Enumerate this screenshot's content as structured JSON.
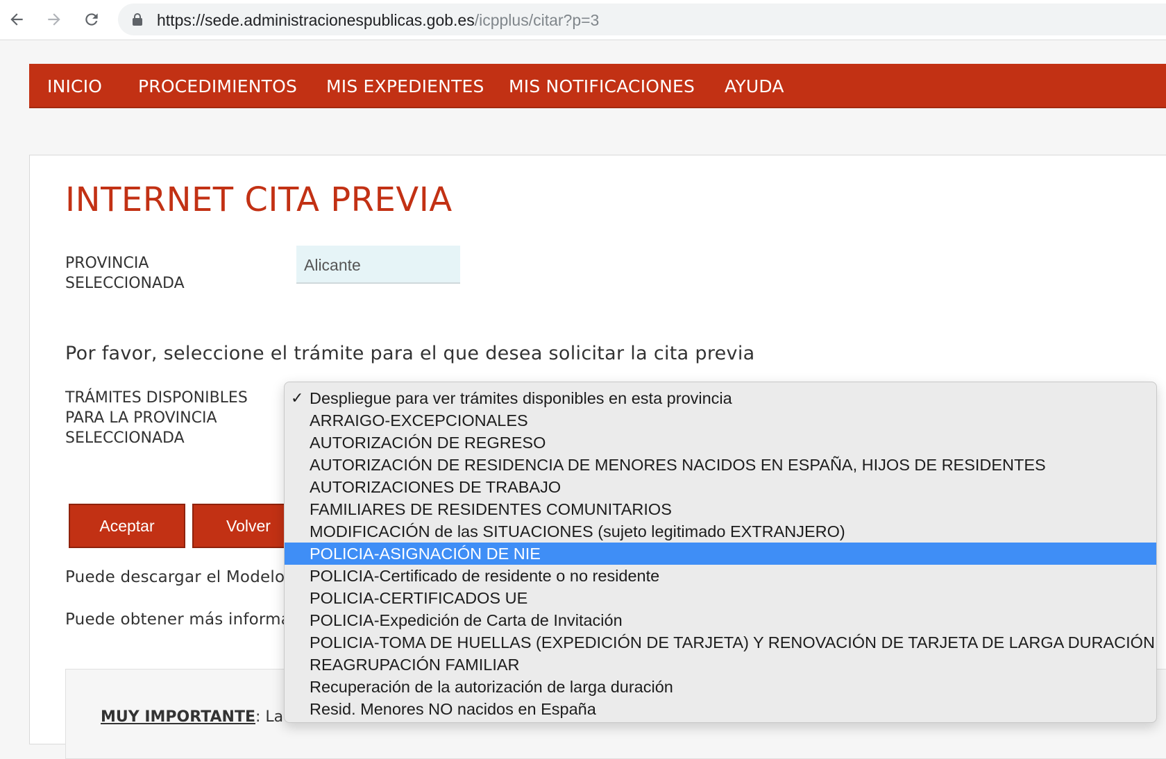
{
  "browser": {
    "url_host": "https://sede.administracionespublicas.gob.es",
    "url_path": "/icpplus/citar?p=3"
  },
  "nav": {
    "items": [
      "INICIO",
      "PROCEDIMIENTOS",
      "MIS EXPEDIENTES",
      "MIS NOTIFICACIONES",
      "AYUDA"
    ]
  },
  "page": {
    "title": "INTERNET CITA PREVIA",
    "province_label_1": "PROVINCIA",
    "province_label_2": "SELECCIONADA",
    "province_value": "Alicante",
    "instruction": "Por favor, seleccione el trámite para el que desea solicitar la cita previa",
    "tramites_label_1": "TRÁMITES DISPONIBLES",
    "tramites_label_2": "PARA LA PROVINCIA",
    "tramites_label_3": "SELECCIONADA",
    "accept_label": "Aceptar",
    "back_label": "Volver",
    "download_text": "Puede descargar el Modelo",
    "info_text": "Puede obtener más informa",
    "important_label": "MUY IMPORTANTE",
    "important_text": ": La"
  },
  "dropdown": {
    "checked_mark": "✓",
    "selected_index": 7,
    "options": [
      "Despliegue para ver trámites disponibles en esta provincia",
      "ARRAIGO-EXCEPCIONALES",
      "AUTORIZACIÓN DE REGRESO",
      "AUTORIZACIÓN DE RESIDENCIA DE MENORES NACIDOS EN ESPAÑA, HIJOS DE RESIDENTES",
      "AUTORIZACIONES DE TRABAJO",
      "FAMILIARES DE RESIDENTES COMUNITARIOS",
      "MODIFICACIÓN de las SITUACIONES (sujeto legitimado EXTRANJERO)",
      "POLICIA-ASIGNACIÓN DE NIE",
      "POLICIA-Certificado de residente o no residente",
      "POLICIA-CERTIFICADOS UE",
      "POLICIA-Expedición de Carta de Invitación",
      "POLICIA-TOMA DE HUELLAS (EXPEDICIÓN DE TARJETA) Y RENOVACIÓN DE TARJETA DE LARGA DURACIÓN",
      "REAGRUPACIÓN FAMILIAR",
      "Recuperación de la autorización de larga duración",
      "Resid. Menores NO nacidos en España"
    ]
  },
  "colors": {
    "brand_red": "#c23114",
    "highlight_blue": "#3f8ef6"
  }
}
